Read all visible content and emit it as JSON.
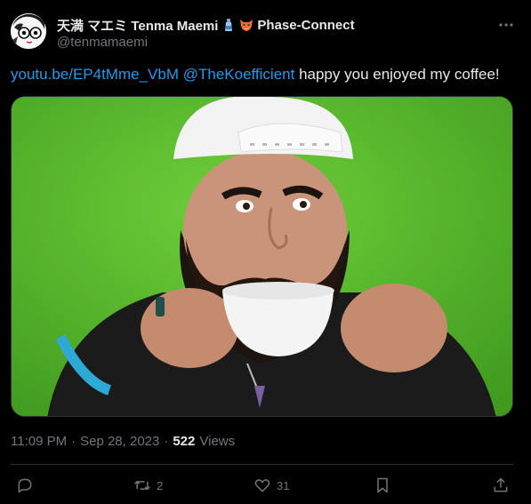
{
  "author": {
    "display_name": "天満 マエミ Tenma Maemi",
    "affiliation": "Phase-Connect",
    "handle": "@tenmamaemi"
  },
  "tweet": {
    "link_text": "youtu.be/EP4tMme_VbM",
    "mention": "@TheKoefficient",
    "body": " happy you enjoyed my coffee!"
  },
  "meta": {
    "time": "11:09 PM",
    "separator": "·",
    "date": "Sep 28, 2023",
    "views_count": "522",
    "views_label": "Views"
  },
  "actions": {
    "replies": "",
    "retweets": "2",
    "likes": "31"
  },
  "colors": {
    "background": "#000000",
    "text": "#e7e9ea",
    "muted": "#71767b",
    "link": "#1d9bf0",
    "divider": "#2f3336"
  },
  "icons": [
    "more-icon",
    "reply-icon",
    "retweet-icon",
    "like-icon",
    "bookmark-icon",
    "share-icon"
  ]
}
